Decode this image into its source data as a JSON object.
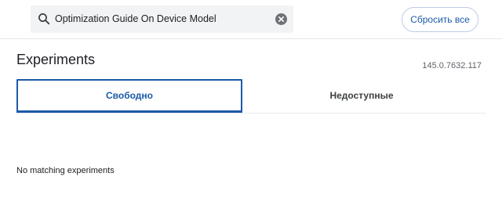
{
  "header": {
    "search": {
      "value": "Optimization Guide On Device Model",
      "icon": "search-icon"
    },
    "clear_icon": "clear-icon",
    "reset_label": "Сбросить все"
  },
  "main": {
    "title": "Experiments",
    "version": "145.0.7632.117",
    "tabs": [
      {
        "label": "Свободно",
        "selected": true
      },
      {
        "label": "Недоступные",
        "selected": false
      }
    ],
    "empty_message": "No matching experiments"
  },
  "colors": {
    "accent": "#1a5aa8",
    "search_bg": "#f1f3f4"
  }
}
